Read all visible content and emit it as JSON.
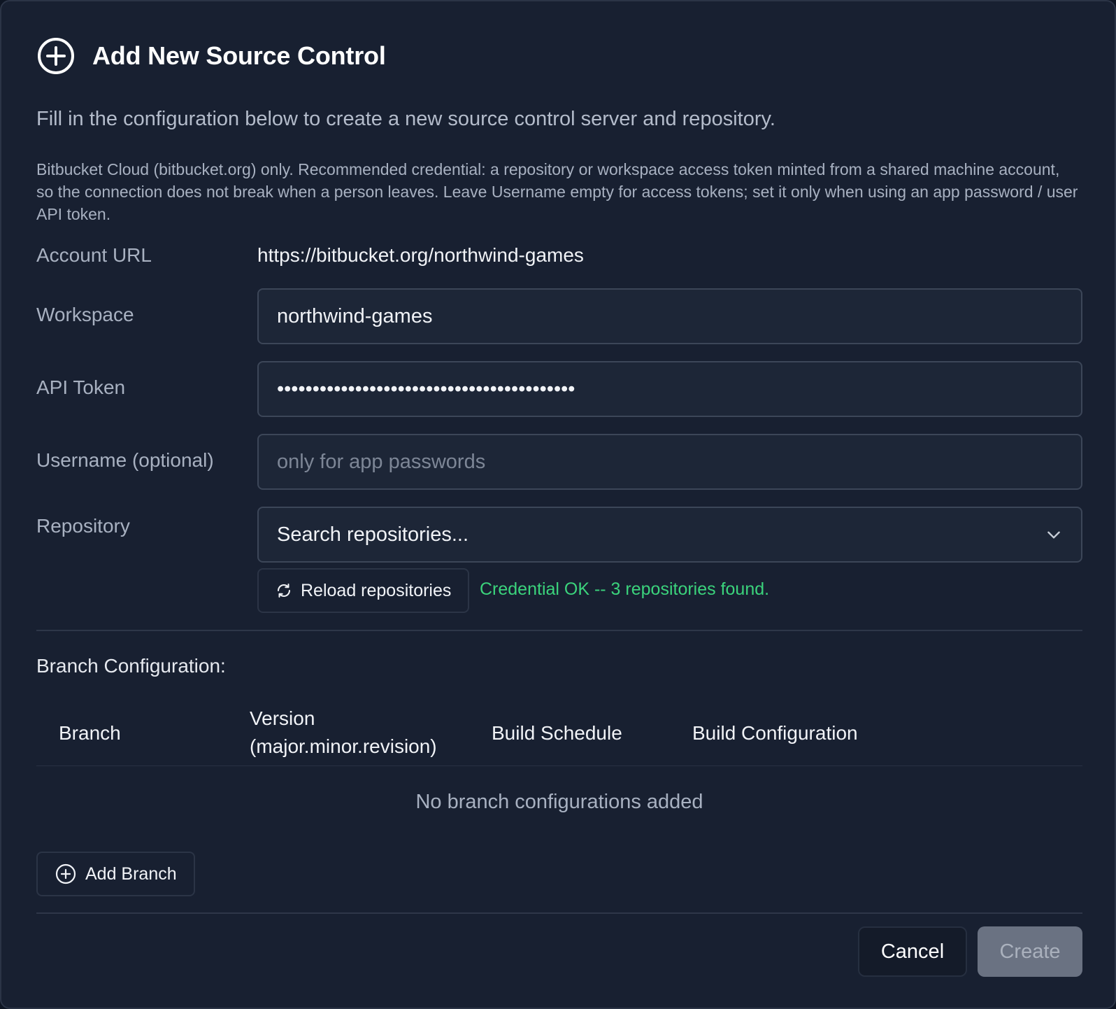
{
  "dialog": {
    "title": "Add New Source Control",
    "title_icon": "plus-circle-icon",
    "subtitle": "Fill in the configuration below to create a new source control server and repository.",
    "note": "Bitbucket Cloud (bitbucket.org) only. Recommended credential: a repository or workspace access token minted from a shared machine account, so the connection does not break when a person leaves. Leave Username empty for access tokens; set it only when using an app password / user API token."
  },
  "form": {
    "account_url": {
      "label": "Account URL",
      "value": "https://bitbucket.org/northwind-games"
    },
    "workspace": {
      "label": "Workspace",
      "value": "northwind-games"
    },
    "api_token": {
      "label": "API Token",
      "value": "••••••••••••••••••••••••••••••••••••••••••"
    },
    "username": {
      "label": "Username (optional)",
      "value": "",
      "placeholder": "only for app passwords"
    },
    "repository": {
      "label": "Repository",
      "value": "Search repositories...",
      "icon": "chevron-down-icon"
    },
    "reload_button": {
      "label": "Reload repositories",
      "icon": "refresh-icon"
    },
    "status": {
      "text": "Credential OK -- 3 repositories found.",
      "color": "#3bd37c"
    }
  },
  "branches": {
    "section_title": "Branch Configuration:",
    "columns": [
      "Branch",
      "Version\n(major.minor.revision)",
      "Build Schedule",
      "Build Configuration"
    ],
    "empty_text": "No branch configurations added",
    "add_button": {
      "label": "Add Branch",
      "icon": "plus-circle-icon"
    }
  },
  "footer": {
    "cancel_label": "Cancel",
    "create_label": "Create"
  }
}
